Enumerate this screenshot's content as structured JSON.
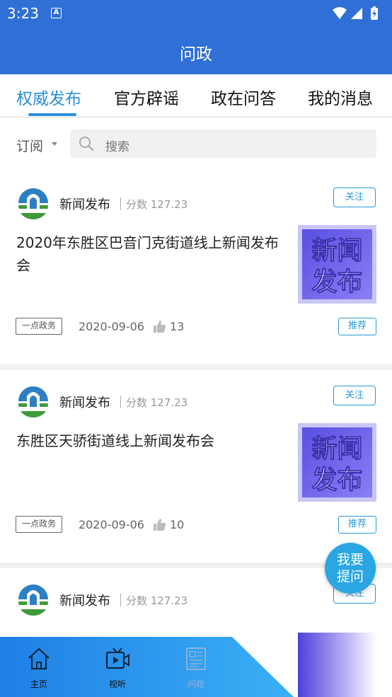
{
  "status_bar": {
    "time": "3:23",
    "badge": "A"
  },
  "header": {
    "title": "问政"
  },
  "tabs": [
    {
      "label": "权威发布"
    },
    {
      "label": "官方辟谣"
    },
    {
      "label": "政在问答"
    },
    {
      "label": "我的消息"
    }
  ],
  "filter": {
    "subscribe_label": "订阅",
    "search_placeholder": "搜索"
  },
  "cards": [
    {
      "source": "新闻发布",
      "score": "分数 127.23",
      "follow_label": "关注",
      "headline": "2020年东胜区巴音门克街道线上新闻发布会",
      "thumb_text": [
        "新闻",
        "发布"
      ],
      "tag": "一点政务",
      "date": "2020-09-06",
      "likes": "13",
      "recommend_label": "推荐"
    },
    {
      "source": "新闻发布",
      "score": "分数 127.23",
      "follow_label": "关注",
      "headline": "东胜区天骄街道线上新闻发布会",
      "thumb_text": [
        "新闻",
        "发布"
      ],
      "tag": "一点政务",
      "date": "2020-09-06",
      "likes": "10",
      "recommend_label": "推荐"
    },
    {
      "source": "新闻发布",
      "score": "分数 127.23",
      "follow_label": "关注"
    }
  ],
  "fab": {
    "line1": "我要",
    "line2": "提问"
  },
  "bottom_nav": [
    {
      "label": "主页",
      "icon": "home-icon"
    },
    {
      "label": "视听",
      "icon": "tv-icon"
    },
    {
      "label": "问政",
      "icon": "document-icon"
    }
  ],
  "colors": {
    "primary": "#2f6fd6",
    "accent": "#2a8fd8",
    "nav_gradient_start": "#1f7fe6",
    "nav_gradient_end": "#3bb0f5"
  }
}
